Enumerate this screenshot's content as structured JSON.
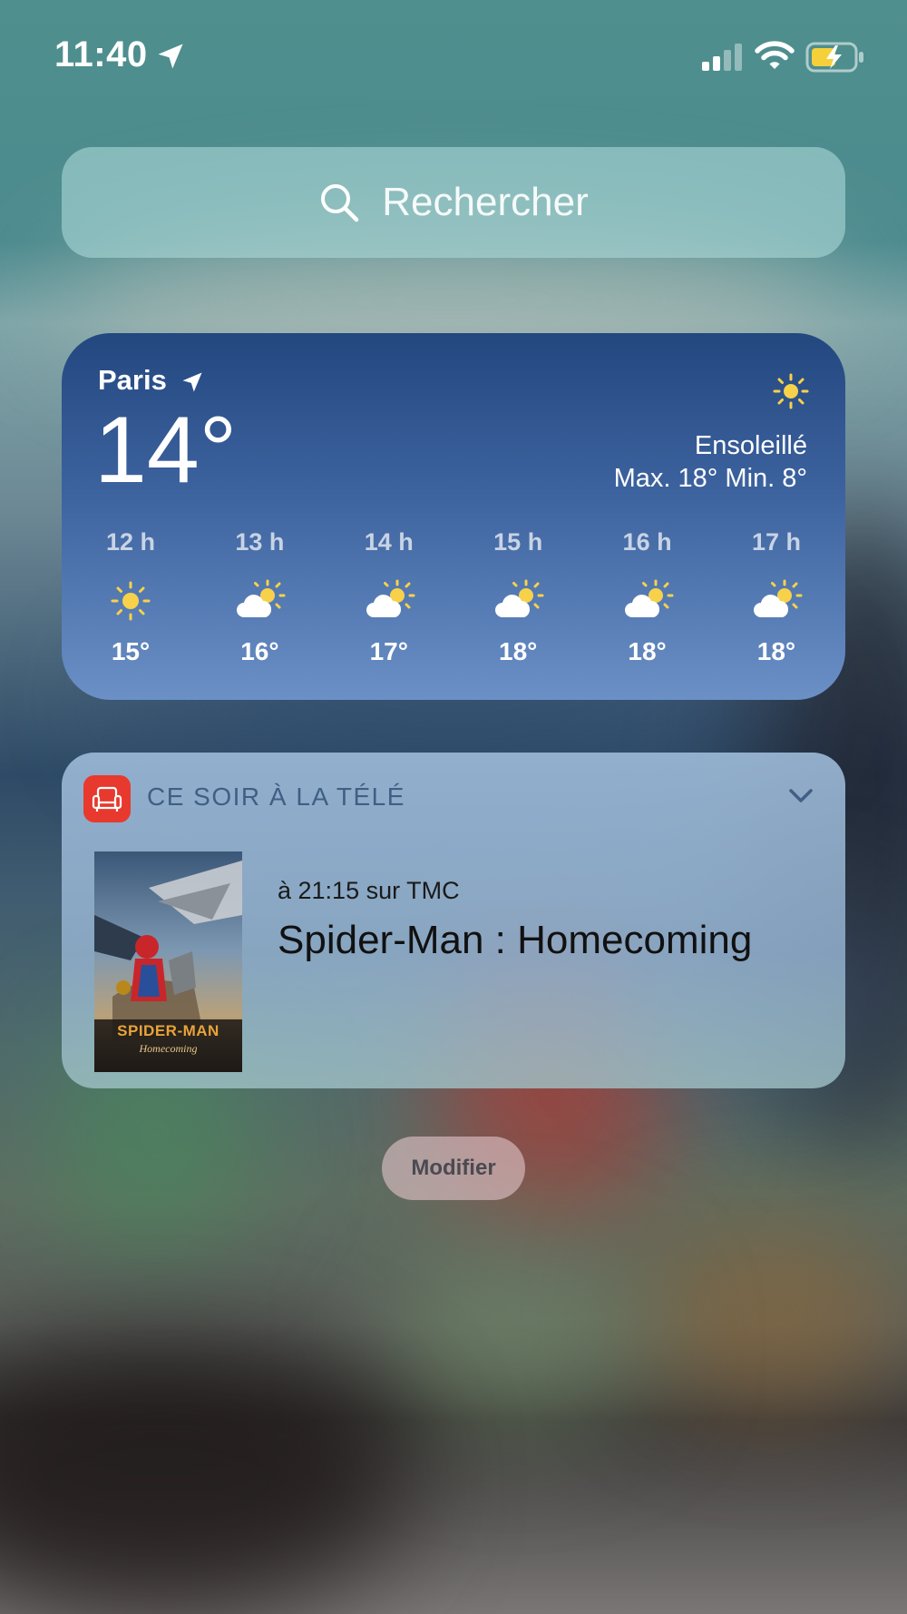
{
  "status_bar": {
    "time": "11:40",
    "icons": [
      "location-arrow-icon",
      "cellular-signal-icon",
      "wifi-icon",
      "battery-charging-icon"
    ]
  },
  "search": {
    "placeholder": "Rechercher",
    "icon": "search-icon"
  },
  "weather": {
    "city": "Paris",
    "current_temp": "14°",
    "condition": "Ensoleillé",
    "min_max": "Max. 18° Min. 8°",
    "condition_icon": "sun-icon",
    "hourly": [
      {
        "hour": "12 h",
        "icon": "sun-icon",
        "temp": "15°"
      },
      {
        "hour": "13 h",
        "icon": "partly-cloudy-icon",
        "temp": "16°"
      },
      {
        "hour": "14 h",
        "icon": "partly-cloudy-icon",
        "temp": "17°"
      },
      {
        "hour": "15 h",
        "icon": "partly-cloudy-icon",
        "temp": "18°"
      },
      {
        "hour": "16 h",
        "icon": "partly-cloudy-icon",
        "temp": "18°"
      },
      {
        "hour": "17 h",
        "icon": "partly-cloudy-icon",
        "temp": "18°"
      }
    ]
  },
  "tv_widget": {
    "title": "CE SOIR À LA TÉLÉ",
    "app_icon": "armchair-icon",
    "broadcast": "à 21:15 sur TMC",
    "show": "Spider-Man : Homecoming",
    "poster_title": "SPIDER-MAN",
    "poster_subtitle": "Homecoming"
  },
  "footer": {
    "edit_label": "Modifier"
  },
  "colors": {
    "weather_top": "#23477f",
    "weather_bottom": "#6b90c6",
    "sun": "#f7d14a",
    "tv_app_red": "#e8392e",
    "tv_title": "#3f5f84"
  }
}
